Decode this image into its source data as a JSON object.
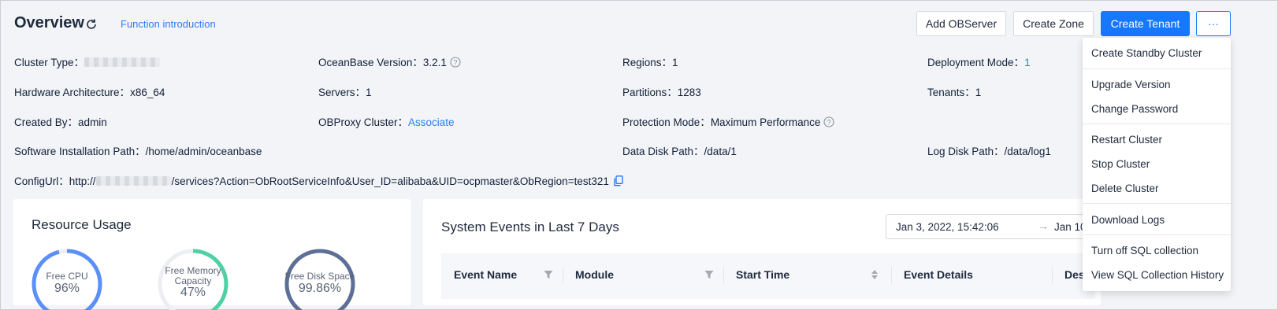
{
  "header": {
    "title": "Overview",
    "function_link": "Function introduction",
    "buttons": {
      "add_observer": "Add OBServer",
      "create_zone": "Create Zone",
      "create_tenant": "Create Tenant",
      "more": "···"
    }
  },
  "info": {
    "cluster_type_label": "Cluster Type：",
    "hardware_label": "Hardware Architecture：",
    "hardware_value": "x86_64",
    "created_by_label": "Created By：",
    "created_by_value": "admin",
    "install_path_label": "Software Installation Path：",
    "install_path_value": "/home/admin/oceanbase",
    "config_url_label": "ConfigUrl：",
    "config_url_prefix": "http://",
    "config_url_suffix": "/services?Action=ObRootServiceInfo&User_ID=alibaba&UID=ocpmaster&ObRegion=test321",
    "ob_version_label": "OceanBase Version：",
    "ob_version_value": "3.2.1",
    "servers_label": "Servers：",
    "servers_value": "1",
    "obproxy_label": "OBProxy Cluster：",
    "obproxy_value": "Associate",
    "regions_label": "Regions：",
    "regions_value": "1",
    "partitions_label": "Partitions：",
    "partitions_value": "1283",
    "protection_label": "Protection Mode：",
    "protection_value": "Maximum Performance",
    "data_disk_label": "Data Disk Path：",
    "data_disk_value": "/data/1",
    "deployment_label": "Deployment Mode：",
    "deployment_value": "1",
    "tenants_label": "Tenants：",
    "tenants_value": "1",
    "log_disk_label": "Log Disk Path：",
    "log_disk_value": "/data/log1"
  },
  "resource": {
    "title": "Resource Usage",
    "gauges": [
      {
        "label": "Free CPU",
        "value": "96%",
        "fraction": 0.96,
        "color": "#5b8ff9"
      },
      {
        "label": "Free Memory Capacity",
        "value": "47%",
        "fraction": 0.47,
        "color": "#4fd1a4"
      },
      {
        "label": "Free Disk Space",
        "value": "99.86%",
        "fraction": 0.9986,
        "color": "#5d6f96"
      }
    ]
  },
  "events": {
    "title": "System Events in Last 7 Days",
    "date_start": "Jan 3, 2022, 15:42:06",
    "date_arrow": "→",
    "date_end": "Jan 10",
    "columns": [
      "Event Name",
      "Module",
      "Start Time",
      "Event Details",
      "Des"
    ]
  },
  "menu": {
    "items": [
      "Create Standby Cluster",
      "Upgrade Version",
      "Change Password",
      "Restart Cluster",
      "Stop Cluster",
      "Delete Cluster",
      "Download Logs",
      "Turn off SQL collection",
      "View SQL Collection History"
    ]
  },
  "colors": {
    "primary": "#1677ff",
    "link": "#2f7cf6"
  }
}
